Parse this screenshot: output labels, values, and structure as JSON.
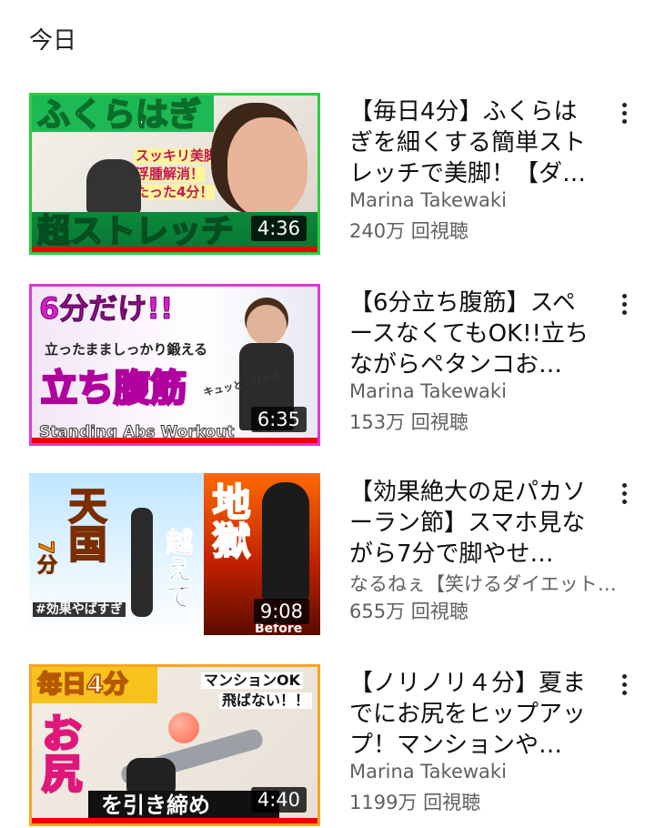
{
  "section_title": "今日",
  "videos": [
    {
      "title": "【毎日4分】ふくらはぎを細くする簡単ストレッチで美脚！【ダ…",
      "channel": "Marina Takewaki",
      "views": "240万 回視聴",
      "duration": "4:36",
      "thumb_text": [
        "ふくらはぎ",
        "スッキリ美脚！",
        "浮腫解消！",
        "たった4分！",
        "超ストレッチ"
      ]
    },
    {
      "title": "【6分立ち腹筋】スペースなくてもOK!!立ちながらペタンコお…",
      "channel": "Marina Takewaki",
      "views": "153万 回視聴",
      "duration": "6:35",
      "thumb_text": [
        "6分だけ!!",
        "立ったまましっかり鍛える",
        "立ち腹筋",
        "キュッとくびれる",
        "Standing Abs Workout"
      ]
    },
    {
      "title": "【効果絶大の足パカソーラン節】スマホ見ながら7分で脚やせ…",
      "channel": "なるねぇ【笑けるダイエット…",
      "views": "655万 回視聴",
      "duration": "9:08",
      "thumb_text": [
        "天国",
        "7分",
        "越えて",
        "地獄",
        "#効果やばすぎ",
        "Before"
      ]
    },
    {
      "title": "【ノリノリ４分】夏までにお尻をヒップアップ！マンションや…",
      "channel": "Marina Takewaki",
      "views": "1199万 回視聴",
      "duration": "4:40",
      "thumb_text": [
        "毎日4分",
        "マンションOK",
        "飛ばない！！",
        "お尻",
        "を引き締め"
      ]
    }
  ],
  "colors": {
    "progress": "#ee0000",
    "meta_text": "#606060"
  },
  "icons": {
    "more": "three-dots-vertical-icon"
  }
}
